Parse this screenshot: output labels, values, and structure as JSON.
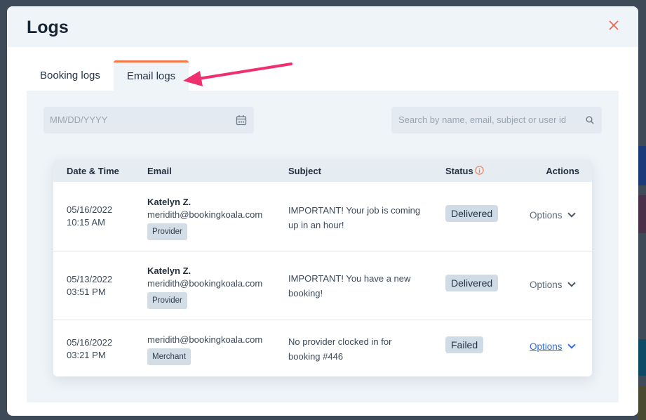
{
  "modal": {
    "title": "Logs",
    "close_icon": "close-icon"
  },
  "tabs": [
    {
      "label": "Booking logs",
      "active": false
    },
    {
      "label": "Email logs",
      "active": true
    }
  ],
  "filters": {
    "date_placeholder": "MM/DD/YYYY",
    "search_placeholder": "Search by name, email, subject or user id"
  },
  "table": {
    "headers": {
      "date": "Date & Time",
      "email": "Email",
      "subject": "Subject",
      "status": "Status",
      "actions": "Actions"
    },
    "rows": [
      {
        "date": "05/16/2022",
        "time": "10:15 AM",
        "name": "Katelyn Z.",
        "email": "meridith@bookingkoala.com",
        "role": "Provider",
        "subject1": "IMPORTANT! Your job is coming",
        "subject2": "up in an hour!",
        "status": "Delivered",
        "action": "Options"
      },
      {
        "date": "05/13/2022",
        "time": "03:51 PM",
        "name": "Katelyn Z.",
        "email": "meridith@bookingkoala.com",
        "role": "Provider",
        "subject1": "IMPORTANT! You have a new",
        "subject2": "booking!",
        "status": "Delivered",
        "action": "Options"
      },
      {
        "date": "05/16/2022",
        "time": "03:21 PM",
        "email": "meridith@bookingkoala.com",
        "role": "Merchant",
        "subject1": "No provider clocked in for",
        "subject2": "booking #446",
        "status": "Failed",
        "action": "Options"
      }
    ]
  },
  "colors": {
    "accent_tab": "#f5784a",
    "link": "#2f6fe4",
    "arrow": "#f0306e"
  }
}
